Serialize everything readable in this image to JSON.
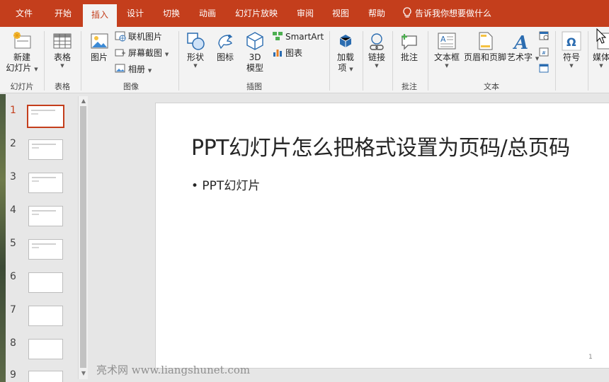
{
  "tabs": [
    {
      "label": "文件",
      "active": false
    },
    {
      "label": "开始",
      "active": false
    },
    {
      "label": "插入",
      "active": true
    },
    {
      "label": "设计",
      "active": false
    },
    {
      "label": "切换",
      "active": false
    },
    {
      "label": "动画",
      "active": false
    },
    {
      "label": "幻灯片放映",
      "active": false
    },
    {
      "label": "审阅",
      "active": false
    },
    {
      "label": "视图",
      "active": false
    },
    {
      "label": "帮助",
      "active": false
    }
  ],
  "tell_me": "告诉我你想要做什么",
  "ribbon": {
    "groups": {
      "slides": "幻灯片",
      "tables": "表格",
      "images": "图像",
      "illustrations": "插图",
      "text": "文本"
    },
    "new_slide_line1": "新建",
    "new_slide_line2": "幻灯片",
    "table": "表格",
    "picture": "图片",
    "online_picture": "联机图片",
    "screenshot": "屏幕截图",
    "album": "相册",
    "shapes": "形状",
    "icons": "图标",
    "model3d_line1": "3D",
    "model3d_line2": "模型",
    "smartart": "SmartArt",
    "chart": "图表",
    "addins_line1": "加载",
    "addins_line2": "项",
    "link": "链接",
    "comment": "批注",
    "comment_group": "批注",
    "textbox": "文本框",
    "header_footer": "页眉和页脚",
    "wordart": "艺术字",
    "symbol": "符号",
    "media": "媒体"
  },
  "thumbnails": [
    {
      "num": "1",
      "selected": true,
      "has_text": true
    },
    {
      "num": "2",
      "selected": false,
      "has_text": true
    },
    {
      "num": "3",
      "selected": false,
      "has_text": true
    },
    {
      "num": "4",
      "selected": false,
      "has_text": true
    },
    {
      "num": "5",
      "selected": false,
      "has_text": true
    },
    {
      "num": "6",
      "selected": false,
      "has_text": false
    },
    {
      "num": "7",
      "selected": false,
      "has_text": false
    },
    {
      "num": "8",
      "selected": false,
      "has_text": false
    },
    {
      "num": "9",
      "selected": false,
      "has_text": false
    }
  ],
  "slide": {
    "title": "PPT幻灯片怎么把格式设置为页码/总页码",
    "bullet": "• PPT幻灯片",
    "page_number": "1"
  },
  "watermark": "亮术网 www.liangshunet.com",
  "colors": {
    "accent": "#c43e1c",
    "ribbon_bg": "#f3f3f3",
    "workspace_bg": "#e6e6e6"
  }
}
